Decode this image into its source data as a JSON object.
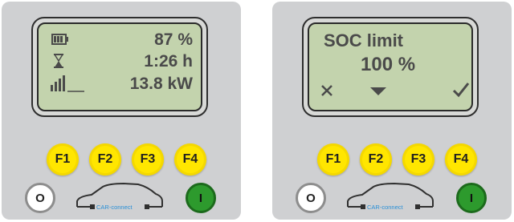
{
  "left": {
    "battery_percent": "87 %",
    "time_remaining": "1:26 h",
    "power": "13.8 kW",
    "icons": [
      "battery-icon",
      "hourglass-icon",
      "signal-strength-icon"
    ]
  },
  "right": {
    "title": "SOC limit",
    "value": "100 %",
    "icons": [
      "cancel-x-icon",
      "down-arrow-icon",
      "confirm-check-icon"
    ]
  },
  "keys": {
    "f1": "F1",
    "f2": "F2",
    "f3": "F3",
    "f4": "F4"
  },
  "off_label": "O",
  "on_label": "I",
  "logo_text": "CAR-connect",
  "colors": {
    "function_key": "#ffe600",
    "on_button": "#2d9a2d",
    "lcd_background": "#c3d3ad",
    "panel": "#cfd0d2"
  }
}
